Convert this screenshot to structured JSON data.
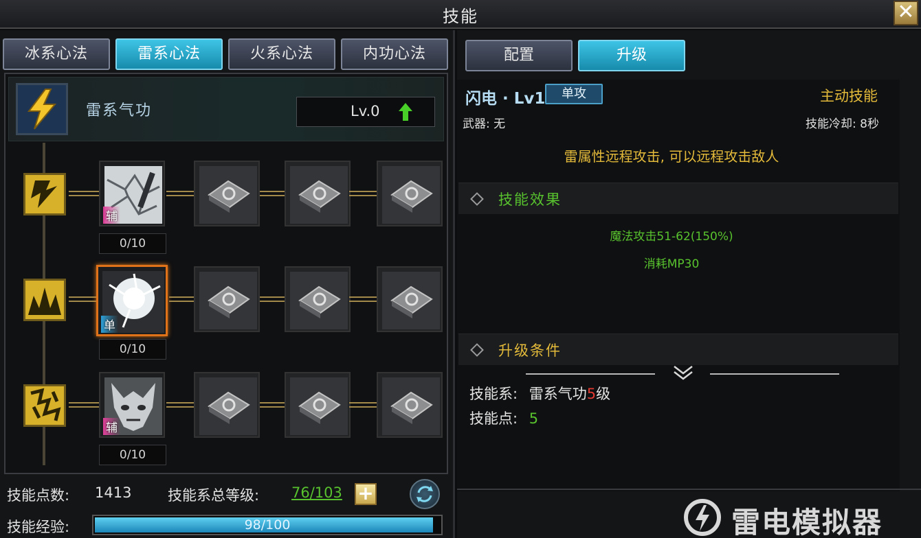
{
  "window": {
    "title": "技能",
    "close_label": "✕"
  },
  "left_tabs": [
    {
      "label": "冰系心法",
      "active": false
    },
    {
      "label": "雷系心法",
      "active": true
    },
    {
      "label": "火系心法",
      "active": false
    },
    {
      "label": "内功心法",
      "active": false
    }
  ],
  "school": {
    "name": "雷系气功",
    "level": "Lv.0",
    "icon": "lightning-icon",
    "upgrade_icon": "up-arrow-icon"
  },
  "rows": [
    {
      "branch_icon": "lightning-bolt-icon",
      "skill": {
        "tag": "辅",
        "count": "0/10",
        "art": "lightning-web-icon"
      }
    },
    {
      "branch_icon": "spike-burst-icon",
      "skill": {
        "tag": "单",
        "count": "0/10",
        "art": "flash-burst-icon",
        "selected": true
      }
    },
    {
      "branch_icon": "cracked-shield-icon",
      "skill": {
        "tag": "辅",
        "count": "0/10",
        "art": "beast-face-icon"
      }
    }
  ],
  "footer": {
    "points_label": "技能点数:",
    "points_value": "1413",
    "total_label": "技能系总等级:",
    "total_value": "76/103",
    "exp_label": "技能经验:",
    "exp_value": "98/100",
    "exp_fraction": 0.98
  },
  "right_tabs": [
    {
      "label": "配置",
      "active": false
    },
    {
      "label": "升级",
      "active": true
    }
  ],
  "detail": {
    "skill_name": "闪电 · Lv1",
    "type_badge": "单攻",
    "kind": "主动技能",
    "weapon": "武器: 无",
    "cooldown": "技能冷却: 8秒",
    "description": "雷属性远程攻击, 可以远程攻击敌人",
    "effect_title": "技能效果",
    "effects": [
      "魔法攻击51-62(150%)",
      "消耗MP30"
    ],
    "req_title": "升级条件",
    "req_school_label": "技能系:",
    "req_school_value": "雷系气功",
    "req_school_level": "5",
    "req_school_suffix": "级",
    "req_points_label": "技能点:",
    "req_points_value": "5"
  },
  "watermark": {
    "text": "雷电模拟器"
  },
  "colors": {
    "accent_cyan": "#2aa8cf",
    "gold": "#e4ba3a",
    "green": "#58c22e",
    "red": "#e03a32",
    "orange_select": "#e0731a"
  }
}
